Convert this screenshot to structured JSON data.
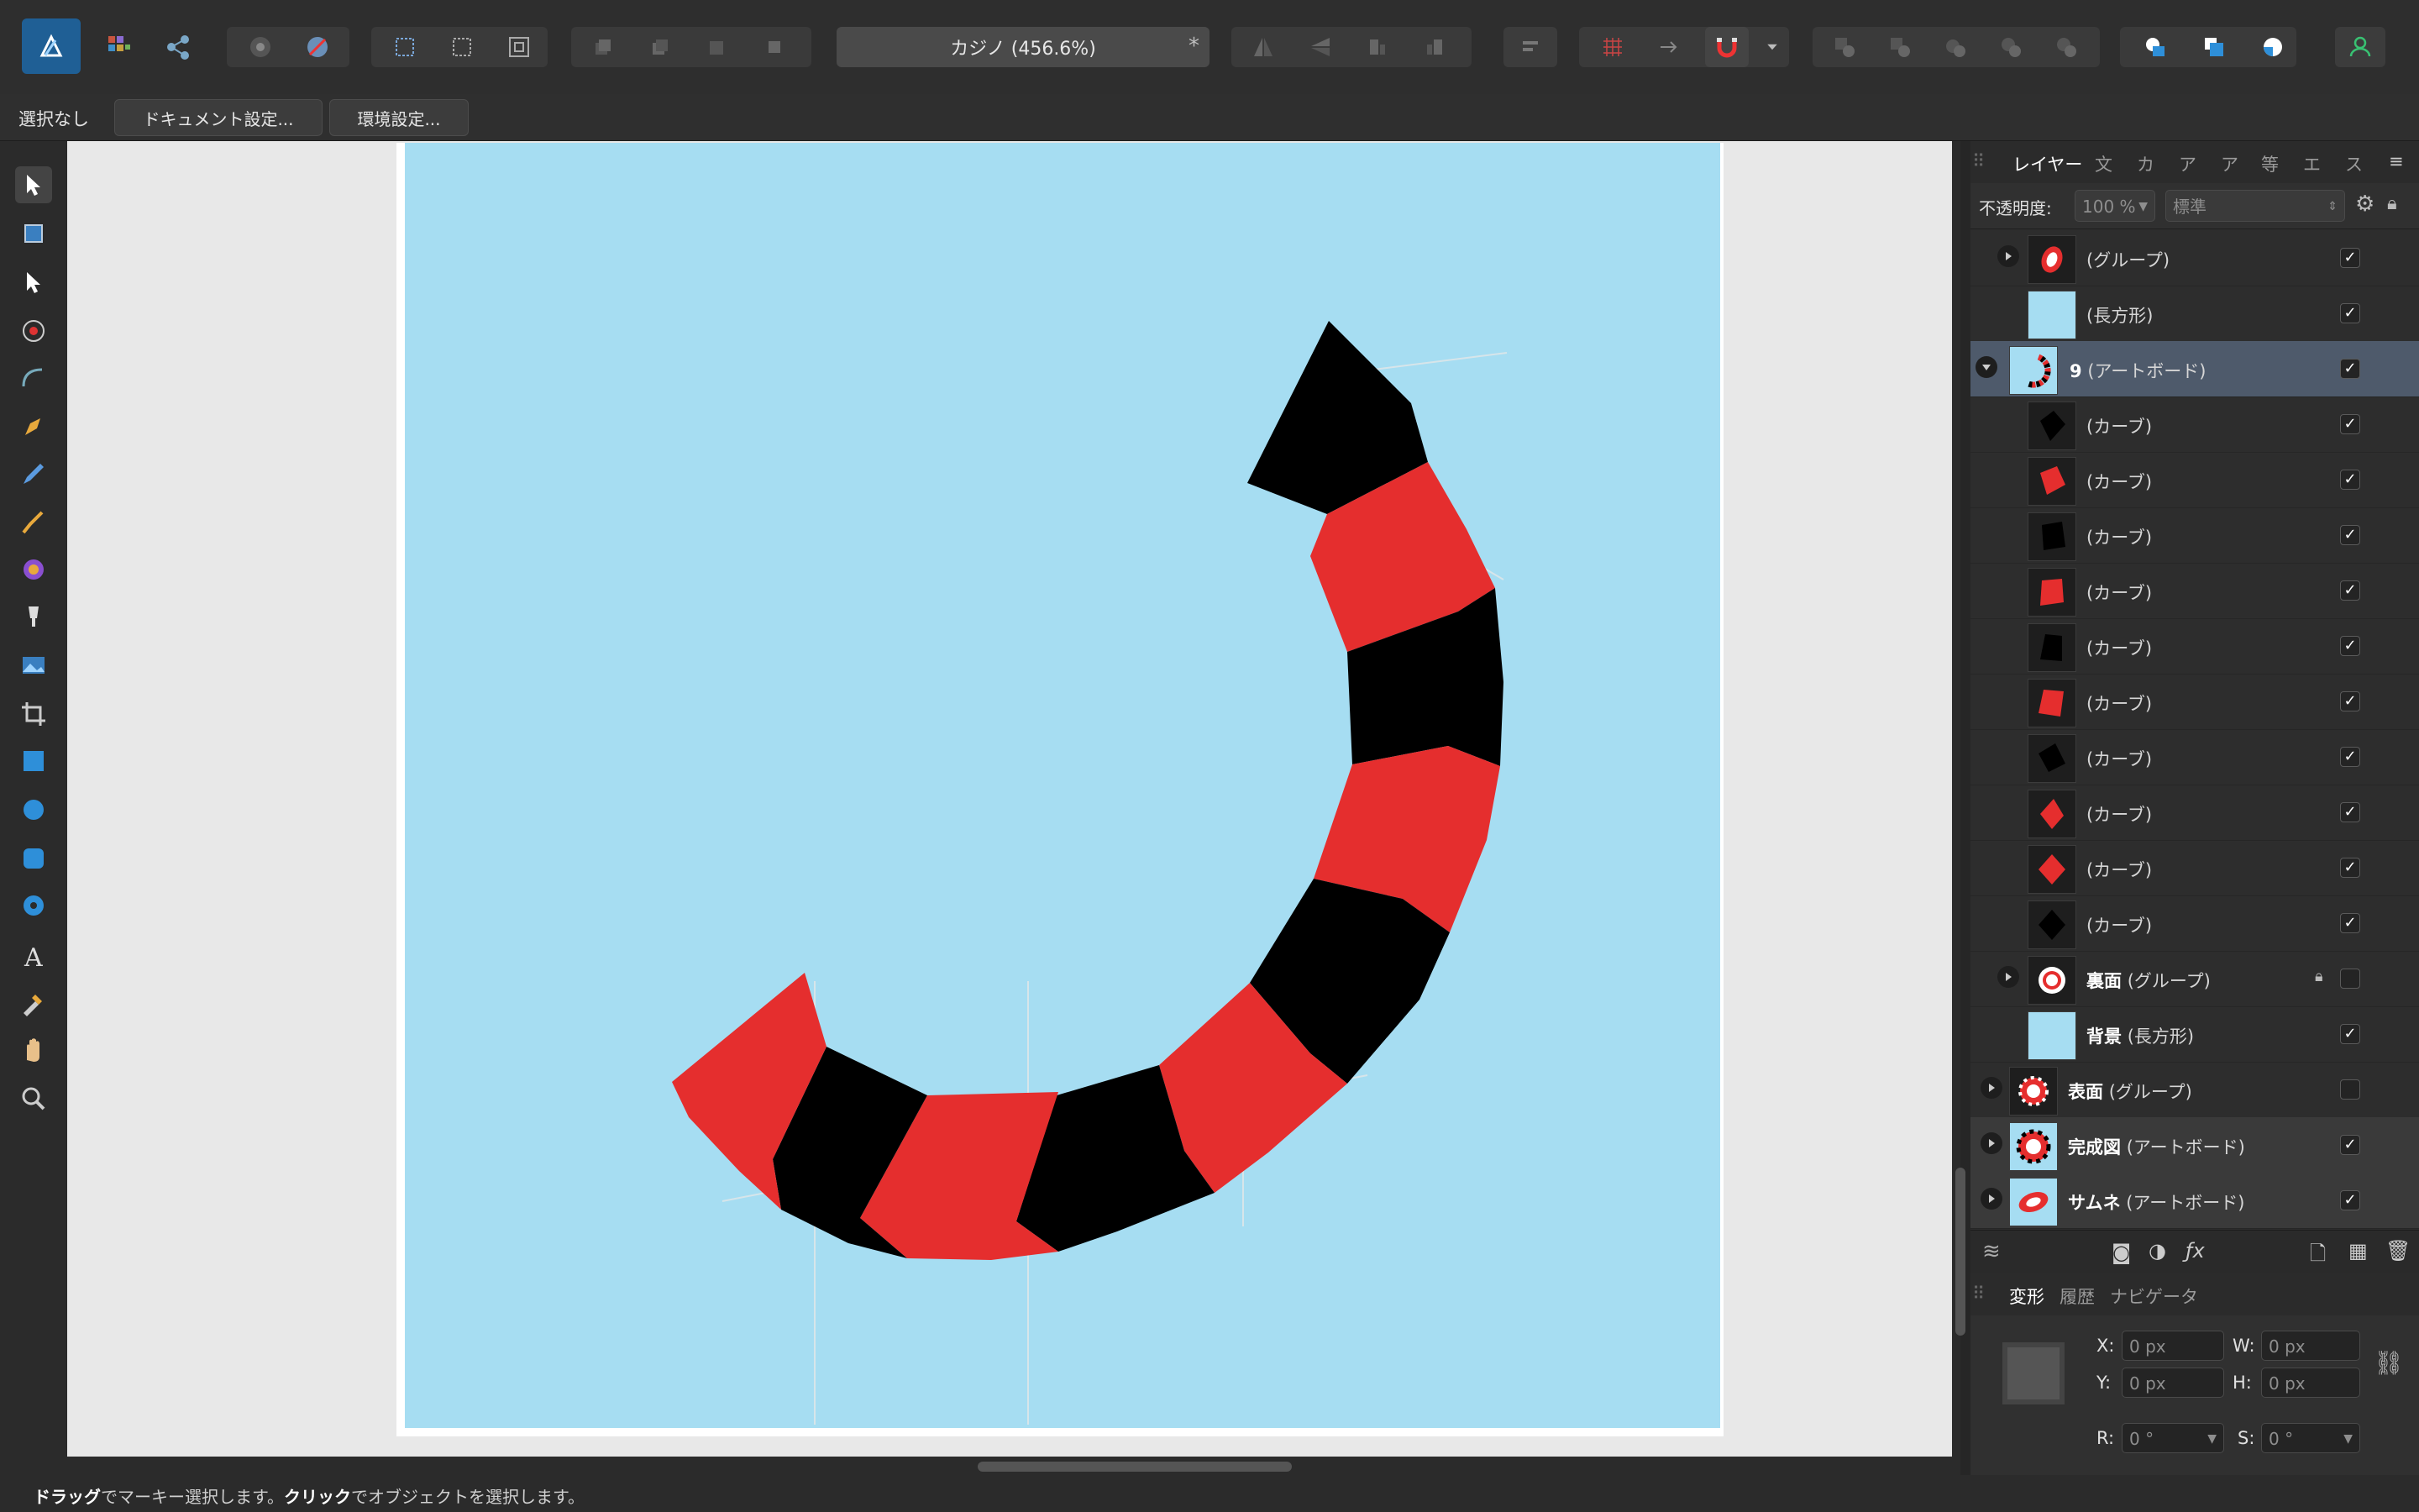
{
  "toolbar": {
    "document_title": "カジノ (456.6%)",
    "modified_mark": "*"
  },
  "context": {
    "selection_status": "選択なし",
    "document_setup_label": "ドキュメント設定...",
    "preferences_label": "環境設定..."
  },
  "status": {
    "drag_bold": "ドラッグ",
    "drag_text": "でマーキー選択します。",
    "click_bold": "クリック",
    "click_text": "でオブジェクトを選択します。"
  },
  "panel": {
    "tabs": [
      "レイヤー",
      "文",
      "カ",
      "ア",
      "ア",
      "等",
      "エ",
      "ス"
    ],
    "opacity_label": "不透明度:",
    "opacity_value": "100 %",
    "blend_mode": "標準"
  },
  "layers": [
    {
      "label": "",
      "type": "(グループ)",
      "expandable": true,
      "visible": true,
      "thumb": "group-chip"
    },
    {
      "label": "",
      "type": "(長方形)",
      "expandable": false,
      "visible": true,
      "thumb": "blue"
    },
    {
      "label": "9",
      "type": "(アートボード)",
      "expandable": true,
      "expanded": true,
      "visible": true,
      "selected": true,
      "thumb": "arc"
    },
    {
      "label": "",
      "type": "(カーブ)",
      "visible": true,
      "thumb": "black"
    },
    {
      "label": "",
      "type": "(カーブ)",
      "visible": true,
      "thumb": "red"
    },
    {
      "label": "",
      "type": "(カーブ)",
      "visible": true,
      "thumb": "black"
    },
    {
      "label": "",
      "type": "(カーブ)",
      "visible": true,
      "thumb": "red"
    },
    {
      "label": "",
      "type": "(カーブ)",
      "visible": true,
      "thumb": "black"
    },
    {
      "label": "",
      "type": "(カーブ)",
      "visible": true,
      "thumb": "red"
    },
    {
      "label": "",
      "type": "(カーブ)",
      "visible": true,
      "thumb": "black"
    },
    {
      "label": "",
      "type": "(カーブ)",
      "visible": true,
      "thumb": "red"
    },
    {
      "label": "",
      "type": "(カーブ)",
      "visible": true,
      "thumb": "red"
    },
    {
      "label": "",
      "type": "(カーブ)",
      "visible": true,
      "thumb": "black"
    },
    {
      "label": "裏面",
      "type": "(グループ)",
      "expandable": true,
      "locked": true,
      "visible": false,
      "thumb": "white-ring"
    },
    {
      "label": "背景",
      "type": "(長方形)",
      "visible": true,
      "thumb": "blue"
    },
    {
      "label": "表面",
      "type": "(グループ)",
      "expandable": true,
      "visible": false,
      "thumb": "chip"
    },
    {
      "label": "完成図",
      "type": "(アートボード)",
      "expandable": true,
      "visible": true,
      "thumb": "chip-blue"
    },
    {
      "label": "サムネ",
      "type": "(アートボード)",
      "expandable": true,
      "visible": true,
      "thumb": "chip-tilt"
    }
  ],
  "transform": {
    "tabs": [
      "変形",
      "履歴",
      "ナビゲータ"
    ],
    "x_label": "X:",
    "x_value": "0 px",
    "y_label": "Y:",
    "y_value": "0 px",
    "w_label": "W:",
    "w_value": "0 px",
    "h_label": "H:",
    "h_value": "0 px",
    "r_label": "R:",
    "r_value": "0 °",
    "s_label": "S:",
    "s_value": "0 °"
  },
  "colors": {
    "artboard_bg": "#a6ddf2",
    "chip_red": "#e52e2e",
    "chip_black": "#000000",
    "accent": "#2e8fd9"
  }
}
